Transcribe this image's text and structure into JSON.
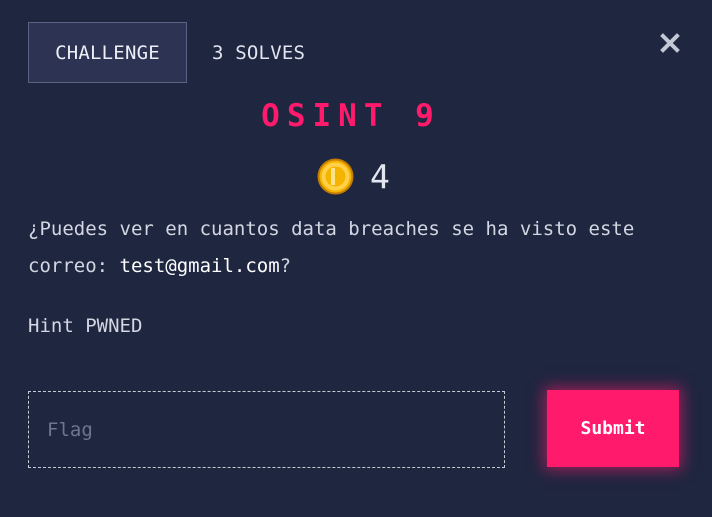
{
  "tabs": [
    {
      "label": "CHALLENGE",
      "active": true
    },
    {
      "label": "3 SOLVES",
      "active": false
    }
  ],
  "close_icon": "close-x-icon",
  "challenge": {
    "title": "OSINT 9",
    "points": "4",
    "points_icon": "coin-icon",
    "description_text": "¿Puedes ver en cuantos data breaches se ha visto este correo: ",
    "description_email": "test@gmail.com",
    "description_end": "?",
    "hint": "Hint PWNED"
  },
  "form": {
    "flag_placeholder": "Flag",
    "flag_value": "",
    "submit_label": "Submit"
  },
  "colors": {
    "background": "#1f2640",
    "accent": "#ff1a6c",
    "coin": "#f5b400"
  }
}
